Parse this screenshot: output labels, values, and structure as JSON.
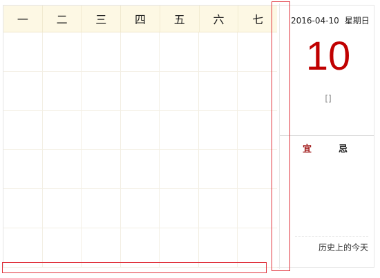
{
  "weekdays": [
    "一",
    "二",
    "三",
    "四",
    "五",
    "六",
    "七"
  ],
  "panel": {
    "date": "2016-04-10",
    "weekday": "星期日",
    "day": "10",
    "lunar": "[]",
    "yi_label": "宜",
    "ji_label": "忌",
    "history_label": "历史上的今天"
  },
  "colors": {
    "header_bg": "#fdf8e4",
    "day_number": "#c00000",
    "yi": "#a01818",
    "highlight": "#e0303a"
  }
}
